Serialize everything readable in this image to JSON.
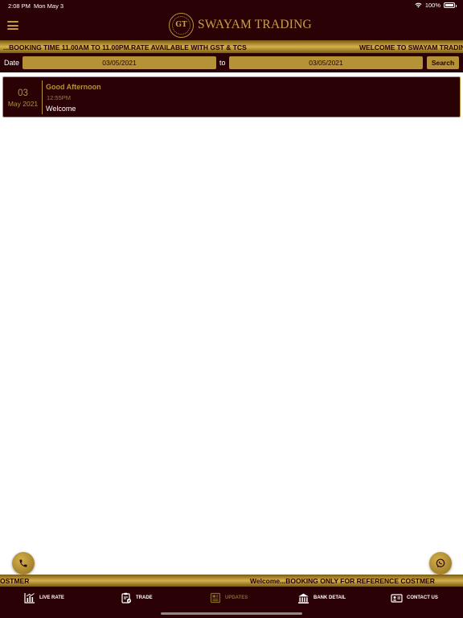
{
  "status": {
    "time": "2:08 PM",
    "date": "Mon May 3",
    "battery": "100%"
  },
  "header": {
    "emblem": "GT",
    "title": "SWAYAM TRADING",
    "menu_icon": "hamburger-icon"
  },
  "ticker_top": {
    "text1": "...BOOKING TIME 11.00AM TO 11.00PM.RATE AVAILABLE WITH GST & TCS",
    "text2": "WELCOME TO SWAYAM TRADING"
  },
  "filter": {
    "date_label": "Date",
    "from": "03/05/2021",
    "to_label": "to",
    "to": "03/05/2021",
    "search_label": "Search"
  },
  "updates": [
    {
      "day": "03",
      "month_year": "May 2021",
      "greeting": "Good Afternoon",
      "time": "12:55PM",
      "message": "Welcome"
    }
  ],
  "ticker_bottom": {
    "text1": "OSTMER",
    "text2": "Welcome...BOOKING ONLY  FOR  REFERENCE COSTMER"
  },
  "tabs": [
    {
      "label": "LIVE RATE",
      "icon": "chart-icon"
    },
    {
      "label": "TRADE",
      "icon": "clipboard-icon"
    },
    {
      "label": "UPDATES",
      "icon": "newspaper-icon",
      "active": true
    },
    {
      "label": "BANK DETAIL",
      "icon": "bank-icon"
    },
    {
      "label": "CONTACT US",
      "icon": "contact-card-icon"
    }
  ],
  "colors": {
    "maroon": "#2a0104",
    "gold": "#b59235",
    "gold_light": "#d4b24a"
  }
}
